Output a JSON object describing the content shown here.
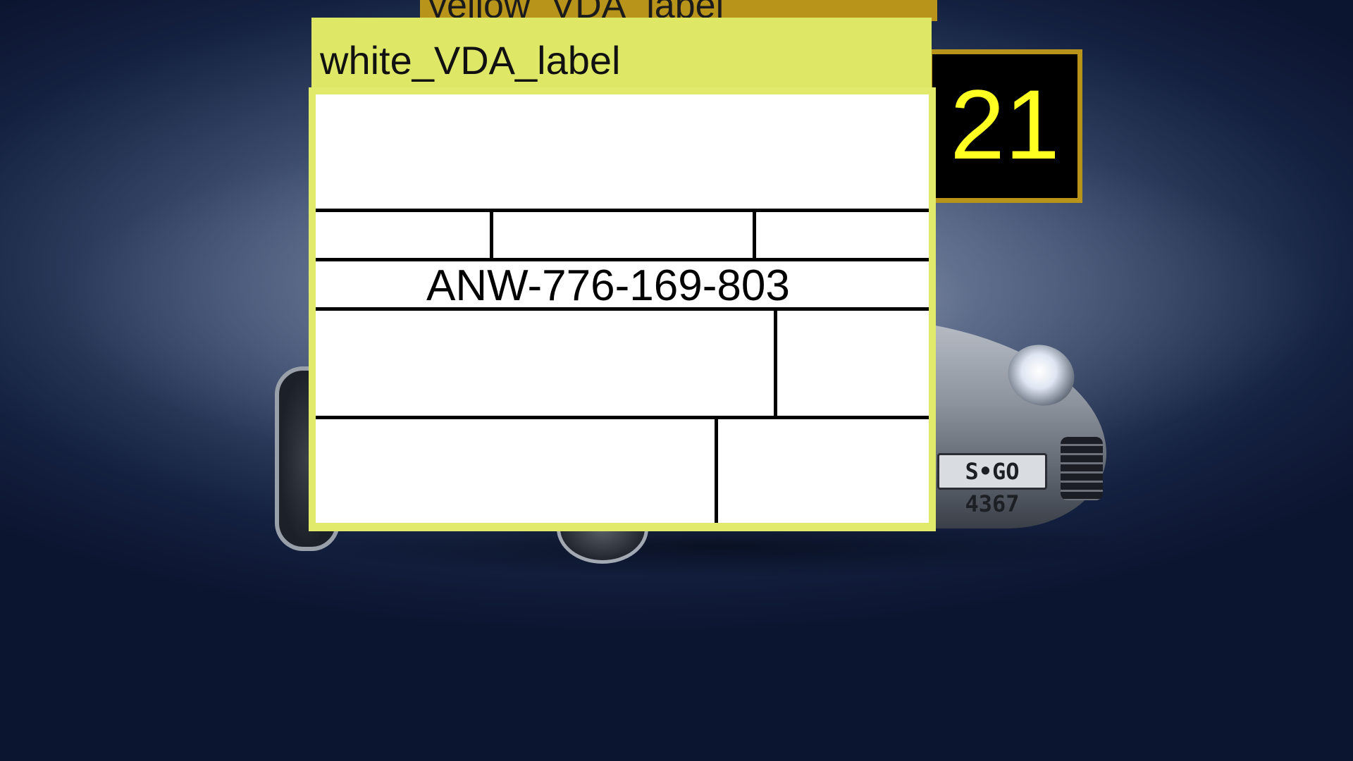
{
  "background": {
    "car_plate": "S•GO 4367"
  },
  "yellow_label": {
    "title": "yellow_VDA_label"
  },
  "badge": {
    "number": "21",
    "text_color": "#ffff22",
    "border_color": "#b8941a"
  },
  "white_label": {
    "title": "white_VDA_label",
    "header_color": "#dfe866",
    "code": "ANW-776-169-803"
  }
}
